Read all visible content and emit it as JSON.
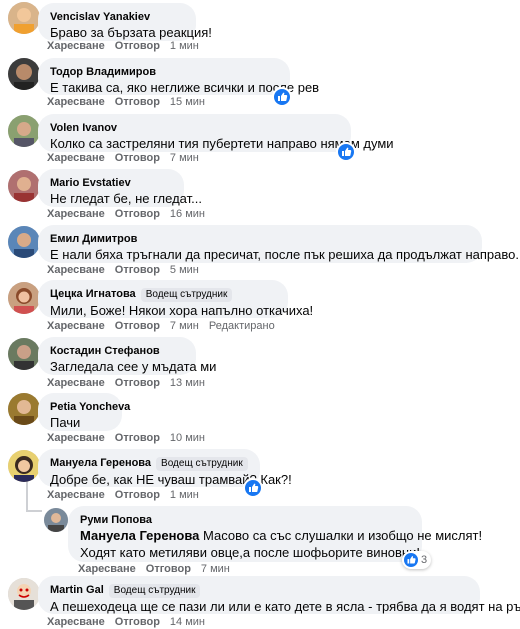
{
  "labels": {
    "like": "Харесване",
    "reply": "Отговор",
    "top_fan": "Водещ сътрудник",
    "edited": "Редактирано"
  },
  "comments": [
    {
      "author": "Vencislav Yanakiev",
      "text": "Браво за бързата реакция!",
      "time": "1 мин"
    },
    {
      "author": "Тодор Владимиров",
      "text": "Е такива са, яко неглиже всички и после рев",
      "time": "15 мин"
    },
    {
      "author": "Volen Ivanov",
      "text": "Колко са застреляни тия пубертети направо нямам думи",
      "time": "7 мин"
    },
    {
      "author": "Mario Evstatiev",
      "text": "Не гледат бе, не гледат...",
      "time": "16 мин"
    },
    {
      "author": "Емил Димитров",
      "text": "Е нали бяха тръгнали да пресичат, после пък решиха да продължат направо...",
      "time": "5 мин"
    },
    {
      "author": "Цецка Игнатова",
      "text": "Мили, Боже! Някои хора напълно откачиха!",
      "time": "7 мин"
    },
    {
      "author": "Костадин Стефанов",
      "text": "Загледала сее у мъдата ми",
      "time": "13 мин"
    },
    {
      "author": "Petia Yoncheva",
      "text": "Пачи",
      "time": "10 мин"
    },
    {
      "author": "Мануела Геренова",
      "text": "Добре бе, как НЕ чуваш трамвай? Как?!",
      "time": "1 мин"
    },
    {
      "author": "Руми Попова",
      "mention": "Мануела Геренова",
      "text": "Масово са със слушалки и изобщо не мислят!",
      "text2": "Ходят като метиляви овце,а после шофьорите виновни!",
      "time": "7 мин",
      "reactions": "3"
    },
    {
      "author": "Martin Gal",
      "text": "А пешеходеца ще се пази ли или е като дете в ясла - трябва да я водят на ръка?!",
      "time": "14 мин"
    }
  ]
}
